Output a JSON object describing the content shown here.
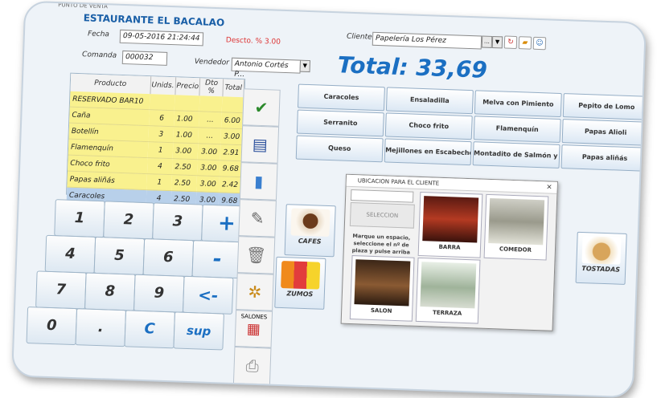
{
  "header": {
    "top_caption": "PUNTO DE VENTA",
    "brand": "ESTAURANTE EL BACALAO",
    "fecha_label": "Fecha",
    "fecha_value": "09-05-2016 21:24:44",
    "descuento": "Descto. % 3.00",
    "comanda_label": "Comanda",
    "comanda_value": "000032",
    "vendedor_label": "Vendedor",
    "vendedor_value": "Antonio Cortés P...",
    "cliente_label": "Cliente",
    "cliente_value": "Papelería Los Pérez",
    "total": "Total: 33,69"
  },
  "table": {
    "headers": [
      "Producto",
      "Unids.",
      "Precio",
      "Dto %",
      "Total"
    ],
    "rows": [
      {
        "producto": "RESERVADO BAR10",
        "unids": "",
        "precio": "",
        "dto": "",
        "total": ""
      },
      {
        "producto": "Caña",
        "unids": "6",
        "precio": "1.00",
        "dto": "...",
        "total": "6.00"
      },
      {
        "producto": "Botellín",
        "unids": "3",
        "precio": "1.00",
        "dto": "...",
        "total": "3.00"
      },
      {
        "producto": "Flamenquín",
        "unids": "1",
        "precio": "3.00",
        "dto": "3.00",
        "total": "2.91"
      },
      {
        "producto": "Choco frito",
        "unids": "4",
        "precio": "2.50",
        "dto": "3.00",
        "total": "9.68"
      },
      {
        "producto": "Papas aliñás",
        "unids": "1",
        "precio": "2.50",
        "dto": "3.00",
        "total": "2.42"
      },
      {
        "producto": "Caracoles",
        "unids": "4",
        "precio": "2.50",
        "dto": "3.00",
        "total": "9.68"
      }
    ]
  },
  "keypad": {
    "keys": [
      "1",
      "2",
      "3",
      "+",
      "4",
      "5",
      "6",
      "-",
      "7",
      "8",
      "9",
      "<-",
      "0",
      ".",
      "C",
      "sup"
    ]
  },
  "side": {
    "salones_label": "SALONES"
  },
  "products": [
    "Caracoles",
    "Ensaladilla",
    "Melva con Pimiento",
    "Pepito de Lomo",
    "Serranito",
    "Choco frito",
    "Flamenquín",
    "Papas Alioli",
    "Queso",
    "Mejillones en Escabeche",
    "Montadito de Salmón y ...",
    "Papas aliñás"
  ],
  "categories": {
    "cafes": "CAFES",
    "zumos": "ZUMOS",
    "tostadas": "TOSTADAS"
  },
  "dialog": {
    "title": "UBICACION PARA EL CLIENTE",
    "seleccion": "SELECCION",
    "instructions": "Marque un espacio, seleccione el nº de plaza y pulse arriba para continuar",
    "close": "×",
    "places": [
      "BARRA",
      "COMEDOR",
      "SALON",
      "TERRAZA"
    ]
  }
}
